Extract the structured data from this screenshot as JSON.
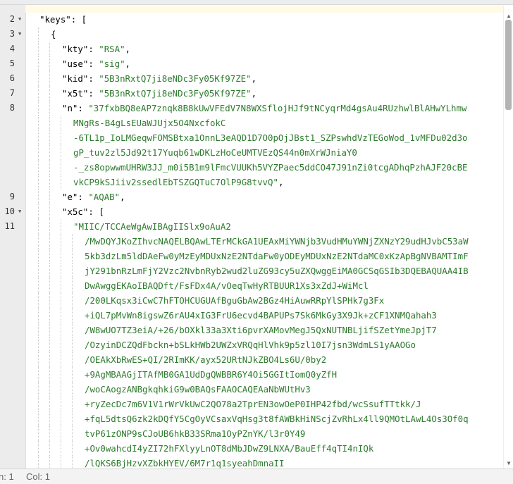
{
  "status": {
    "line": "n: 1",
    "col": "Col: 1"
  },
  "lines": [
    {
      "num": "2",
      "fold": true,
      "indent": 0,
      "parts": [
        [
          "key",
          "\"keys\""
        ],
        [
          "punc",
          ": ["
        ]
      ]
    },
    {
      "num": "3",
      "fold": true,
      "indent": 1,
      "parts": [
        [
          "punc",
          "{"
        ]
      ]
    },
    {
      "num": "4",
      "fold": false,
      "indent": 2,
      "parts": [
        [
          "key",
          "\"kty\""
        ],
        [
          "punc",
          ": "
        ],
        [
          "str",
          "\"RSA\""
        ],
        [
          "punc",
          ","
        ]
      ]
    },
    {
      "num": "5",
      "fold": false,
      "indent": 2,
      "parts": [
        [
          "key",
          "\"use\""
        ],
        [
          "punc",
          ": "
        ],
        [
          "str",
          "\"sig\""
        ],
        [
          "punc",
          ","
        ]
      ]
    },
    {
      "num": "6",
      "fold": false,
      "indent": 2,
      "parts": [
        [
          "key",
          "\"kid\""
        ],
        [
          "punc",
          ": "
        ],
        [
          "str",
          "\"5B3nRxtQ7ji8eNDc3Fy05Kf97ZE\""
        ],
        [
          "punc",
          ","
        ]
      ]
    },
    {
      "num": "7",
      "fold": false,
      "indent": 2,
      "parts": [
        [
          "key",
          "\"x5t\""
        ],
        [
          "punc",
          ": "
        ],
        [
          "str",
          "\"5B3nRxtQ7ji8eNDc3Fy05Kf97ZE\""
        ],
        [
          "punc",
          ","
        ]
      ]
    },
    {
      "num": "8",
      "fold": false,
      "indent": 2,
      "parts": [
        [
          "key",
          "\"n\""
        ],
        [
          "punc",
          ": "
        ],
        [
          "str",
          "\"37fxbBQ8eAP7znqk8B8kUwVFEdV7N8WXSflojHJf9tNCyqrMd4gsAu4RUzhwlBlAHwYLhmw"
        ]
      ]
    },
    {
      "num": "",
      "fold": false,
      "indent": 3,
      "parts": [
        [
          "str",
          "MNgRs-B4gLsEUaWJUjx5O4NxcfokC"
        ]
      ]
    },
    {
      "num": "",
      "fold": false,
      "indent": 3,
      "parts": [
        [
          "str",
          "-6TL1p_IoLMGeqwFOMSBtxa1OnnL3eAQD1D7O0pOjJBst1_SZPswhdVzTEGoWod_1vMFDu02d3o"
        ]
      ]
    },
    {
      "num": "",
      "fold": false,
      "indent": 3,
      "parts": [
        [
          "str",
          "gP_tuv2zl5Jd92t17Yuqb61wDKLzHoCeUMTVEzQS44n0mXrWJniaY0"
        ]
      ]
    },
    {
      "num": "",
      "fold": false,
      "indent": 3,
      "parts": [
        [
          "str",
          "-_zs8opwwmUHRW3JJ_m0i5B1m9lFmcVUUKh5VYZPaec5ddCO47J91nZi0tcgADhqPzhAJF20cBE"
        ]
      ]
    },
    {
      "num": "",
      "fold": false,
      "indent": 3,
      "parts": [
        [
          "str",
          "vkCP9kSJiiv2ssedlEbTSZGQTuC7OlP9G8tvvQ\""
        ],
        [
          "punc",
          ","
        ]
      ]
    },
    {
      "num": "9",
      "fold": false,
      "indent": 2,
      "parts": [
        [
          "key",
          "\"e\""
        ],
        [
          "punc",
          ": "
        ],
        [
          "str",
          "\"AQAB\""
        ],
        [
          "punc",
          ","
        ]
      ]
    },
    {
      "num": "10",
      "fold": true,
      "indent": 2,
      "parts": [
        [
          "key",
          "\"x5c\""
        ],
        [
          "punc",
          ": ["
        ]
      ]
    },
    {
      "num": "11",
      "fold": false,
      "indent": 3,
      "parts": [
        [
          "str",
          "\"MIIC/TCCAeWgAwIBAgIISlx9oAuA2"
        ]
      ]
    },
    {
      "num": "",
      "fold": false,
      "indent": 4,
      "parts": [
        [
          "str",
          "/MwDQYJKoZIhvcNAQELBQAwLTErMCkGA1UEAxMiYWNjb3VudHMuYWNjZXNzY29udHJvbC53aW"
        ]
      ]
    },
    {
      "num": "",
      "fold": false,
      "indent": 4,
      "parts": [
        [
          "str",
          "5kb3dzLm5ldDAeFw0yMzEyMDUxNzE2NTdaFw0yODEyMDUxNzE2NTdaMC0xKzApBgNVBAMTImF"
        ]
      ]
    },
    {
      "num": "",
      "fold": false,
      "indent": 4,
      "parts": [
        [
          "str",
          "jY291bnRzLmFjY2Vzc2NvbnRyb2wud2luZG93cy5uZXQwggEiMA0GCSqGSIb3DQEBAQUAA4IB"
        ]
      ]
    },
    {
      "num": "",
      "fold": false,
      "indent": 4,
      "parts": [
        [
          "str",
          "DwAwggEKAoIBAQDft/FsFDx4A/vOeqTwHyRTBUUR1Xs3xZdJ+WiMcl"
        ]
      ]
    },
    {
      "num": "",
      "fold": false,
      "indent": 4,
      "parts": [
        [
          "str",
          "/200LKqsx3iCwC7hFTOHCUGUAfBguGbAw2BGz4HiAuwRRpYlSPHk7g3Fx"
        ]
      ]
    },
    {
      "num": "",
      "fold": false,
      "indent": 4,
      "parts": [
        [
          "str",
          "+iQL7pMvWn8igswZ6rAU4xIG3FrU6ecvd4BAPUPs7Sk6MkGy3X9Jk+zCF1XNMQahah3"
        ]
      ]
    },
    {
      "num": "",
      "fold": false,
      "indent": 4,
      "parts": [
        [
          "str",
          "/W8wUO7TZ3eiA/+26/bOXkl33a3Xti6pvrXAMovMegJ5QxNUTNBLjifSZetYmeJpjT7"
        ]
      ]
    },
    {
      "num": "",
      "fold": false,
      "indent": 4,
      "parts": [
        [
          "str",
          "/OzyinDCZQdFbckn+bSLkHWb2UWZxVRQqHlVhk9p5zl10I7jsn3WdmLS1yAAOGo"
        ]
      ]
    },
    {
      "num": "",
      "fold": false,
      "indent": 4,
      "parts": [
        [
          "str",
          "/OEAkXbRwES+QI/2RImKK/ayx52URtNJkZBO4Ls6U/0by2"
        ]
      ]
    },
    {
      "num": "",
      "fold": false,
      "indent": 4,
      "parts": [
        [
          "str",
          "+9AgMBAAGjITAfMB0GA1UdDgQWBBR6Y4Oi5GGItIomQ0yZfH"
        ]
      ]
    },
    {
      "num": "",
      "fold": false,
      "indent": 4,
      "parts": [
        [
          "str",
          "/woCAogzANBgkqhkiG9w0BAQsFAAOCAQEAaNbWUtHv3"
        ]
      ]
    },
    {
      "num": "",
      "fold": false,
      "indent": 4,
      "parts": [
        [
          "str",
          "+ryZecDc7m6V1V1rWrVkUwC2QO78a2TprEN3owOeP0IHP42fbd/wcSsufTTtkk/J"
        ]
      ]
    },
    {
      "num": "",
      "fold": false,
      "indent": 4,
      "parts": [
        [
          "str",
          "+fqL5dtsQ6zk2kDQfY5CgOyVCsaxVqHsg3t8fAWBkHiNScjZvRhLx4ll9QMOtLAwL4Os3Of0q"
        ]
      ]
    },
    {
      "num": "",
      "fold": false,
      "indent": 4,
      "parts": [
        [
          "str",
          "tvP61zONP9sCJoUB6hkB33SRma1OyPZnYK/l3r0Y49"
        ]
      ]
    },
    {
      "num": "",
      "fold": false,
      "indent": 4,
      "parts": [
        [
          "str",
          "+Ov0wahcdI4yZI72hFXlyyLnOT8dMbJDwZ9LNXA/BauEff4qTI4nIQk"
        ]
      ]
    },
    {
      "num": "",
      "fold": false,
      "indent": 4,
      "parts": [
        [
          "str",
          "/lQKS6BjHzvXZbkHYEV/6M7r1q1syeahDmnaII"
        ]
      ]
    }
  ]
}
